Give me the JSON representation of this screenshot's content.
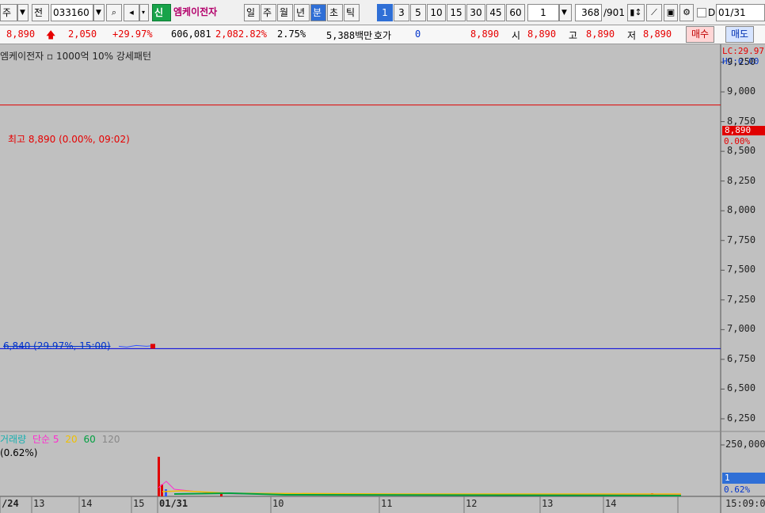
{
  "toolbar": {
    "market_btn": "주",
    "market_arrow": "▼",
    "all_label": "전",
    "code": "033160",
    "code_arrow": "▼",
    "search_icon": "search-icon",
    "new_badge": "신",
    "stock_name": "엠케이전자",
    "periods": [
      "일",
      "주",
      "월",
      "년",
      "분",
      "초",
      "틱"
    ],
    "active_period": "분",
    "intervals": [
      "1",
      "3",
      "5",
      "10",
      "15",
      "30",
      "45",
      "60"
    ],
    "active_interval": "1",
    "count_value": "1",
    "count_arrow": "▼",
    "position": "368",
    "total": "/901",
    "checkbox_label": "D",
    "date_value": "01/31"
  },
  "quote": {
    "price": "8,890",
    "arrow": "🡅",
    "change": "2,050",
    "change_pct": "+29.97%",
    "volume": "606,081",
    "volume_pct": "2,082.82%",
    "turnover": "2.75%",
    "amount": "5,388백만",
    "hoga_label": "호가",
    "hoga_value": "0",
    "hoga_price": "8,890",
    "open_label": "시",
    "open": "8,890",
    "high_label": "고",
    "high": "8,890",
    "low_label": "저",
    "low": "8,890",
    "buy_label": "매수",
    "sell_label": "매도"
  },
  "chart": {
    "title": "엠케이전자 ▫ 1000억 10% 강세패턴",
    "lc_label": "LC:29.97",
    "hc_label": "HC:0.00",
    "high_annotation": "최고 8,890 (0.00%, 09:02)",
    "low_annotation": "6,840 (29.97%, 15:00)",
    "current_price_tag": "8,890",
    "current_pct_tag": "0.00%",
    "volume_legend": {
      "name": "거래량",
      "ma_label": "단순",
      "ma1": "5",
      "ma2": "20",
      "ma3": "60",
      "ma4": "120"
    },
    "volume_sub": "(0.62%)",
    "volume_tag": "1",
    "volume_pct_tag": "0.62%",
    "time_label": "15:09:00",
    "colors": {
      "high_line": "#e00000",
      "low_line": "#0000e0",
      "ma5": "#ff2bd0",
      "ma20": "#f0c000",
      "ma60": "#00a040",
      "ma120": "#888888",
      "volume_name": "#18b0b0"
    }
  },
  "chart_data": {
    "type": "line",
    "price_axis": [
      "9,250",
      "9,000",
      "8,750",
      "8,500",
      "8,250",
      "8,000",
      "7,750",
      "7,500",
      "7,250",
      "7,000",
      "6,750",
      "6,500",
      "6,250"
    ],
    "volume_axis": [
      "250,000"
    ],
    "x_labels": [
      "/24",
      "13",
      "14",
      "15",
      "01/31",
      "10",
      "11",
      "12",
      "13",
      "14"
    ],
    "ylim": [
      6150,
      9400
    ],
    "high_price": 8890,
    "low_price": 6840
  }
}
